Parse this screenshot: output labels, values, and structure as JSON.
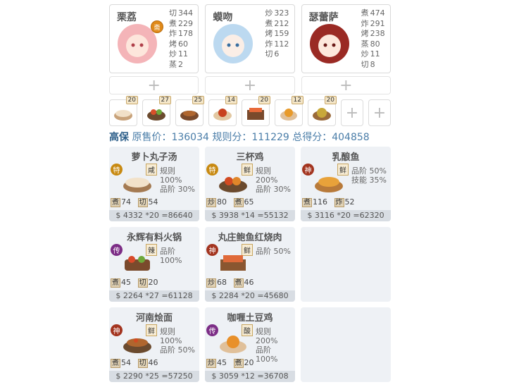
{
  "chefs": [
    {
      "name": "栗荔",
      "skills": [
        [
          "切",
          "344"
        ],
        [
          "煮",
          "229"
        ],
        [
          "炸",
          "178"
        ],
        [
          "烤",
          "60"
        ],
        [
          "炒",
          "11"
        ],
        [
          "蒸",
          "2"
        ]
      ],
      "medal": "斋"
    },
    {
      "name": "蟆吻",
      "skills": [
        [
          "炒",
          "323"
        ],
        [
          "煮",
          "212"
        ],
        [
          "烤",
          "159"
        ],
        [
          "炸",
          "112"
        ],
        [
          "切",
          "6"
        ]
      ]
    },
    {
      "name": "瑟蕾萨",
      "skills": [
        [
          "煮",
          "474"
        ],
        [
          "炸",
          "291"
        ],
        [
          "烤",
          "238"
        ],
        [
          "蒸",
          "80"
        ],
        [
          "炒",
          "11"
        ],
        [
          "切",
          "8"
        ]
      ]
    }
  ],
  "add_symbol": "+",
  "dish_slots": [
    {
      "count": "20",
      "icon": "dish-icon"
    },
    {
      "count": "27",
      "icon": "dish-icon"
    },
    {
      "count": "25",
      "icon": "dish-icon"
    },
    {
      "count": "14",
      "icon": "dish-icon"
    },
    {
      "count": "20",
      "icon": "dish-icon"
    },
    {
      "count": "12",
      "icon": "dish-icon"
    },
    {
      "count": "20",
      "icon": "dish-icon"
    }
  ],
  "summary": {
    "label": "高保",
    "text": "原售价：136034 规则分：111229 总得分：404858"
  },
  "recipes": [
    {
      "title": "萝卜丸子汤",
      "tier": "特",
      "flavor": "咸",
      "stats": [
        "规则 100%",
        "品阶 30%"
      ],
      "reqs": [
        [
          "煮",
          "74"
        ],
        [
          "切",
          "54"
        ]
      ],
      "price": "$ 4332 *20 =86640"
    },
    {
      "title": "三杯鸡",
      "tier": "特",
      "flavor": "鲜",
      "stats": [
        "规则 200%",
        "品阶 30%"
      ],
      "reqs": [
        [
          "炒",
          "80"
        ],
        [
          "煮",
          "65"
        ]
      ],
      "price": "$ 3938 *14 =55132"
    },
    {
      "title": "乳酿鱼",
      "tier": "神",
      "flavor": "鲜",
      "stats": [
        "品阶 50%",
        "技能 35%"
      ],
      "reqs": [
        [
          "煮",
          "116"
        ],
        [
          "炸",
          "52"
        ]
      ],
      "price": "$ 3116 *20 =62320"
    },
    {
      "title": "永辉有料火锅",
      "tier": "传",
      "flavor": "辣",
      "stats": [
        "品阶 100%"
      ],
      "reqs": [
        [
          "煮",
          "45"
        ],
        [
          "切",
          "20"
        ]
      ],
      "price": "$ 2264 *27 =61128"
    },
    {
      "title": "丸庄鲍鱼红烧肉",
      "tier": "神",
      "flavor": "鲜",
      "stats": [
        "品阶 50%"
      ],
      "reqs": [
        [
          "炒",
          "68"
        ],
        [
          "煮",
          "46"
        ]
      ],
      "price": "$ 2284 *20 =45680"
    },
    {
      "title": "河南烩面",
      "tier": "神",
      "flavor": "鲜",
      "stats": [
        "规则 100%",
        "品阶 50%"
      ],
      "reqs": [
        [
          "煮",
          "54"
        ],
        [
          "切",
          "46"
        ]
      ],
      "price": "$ 2290 *25 =57250"
    },
    {
      "title": "咖喱土豆鸡",
      "tier": "传",
      "flavor": "酸",
      "stats": [
        "规则 200%",
        "品阶 100%"
      ],
      "reqs": [
        [
          "炒",
          "45"
        ],
        [
          "煮",
          "20"
        ]
      ],
      "price": "$ 3059 *12 =36708"
    }
  ],
  "colors": {
    "accent": "#4a7da8",
    "card_bg": "#eef1f5"
  }
}
